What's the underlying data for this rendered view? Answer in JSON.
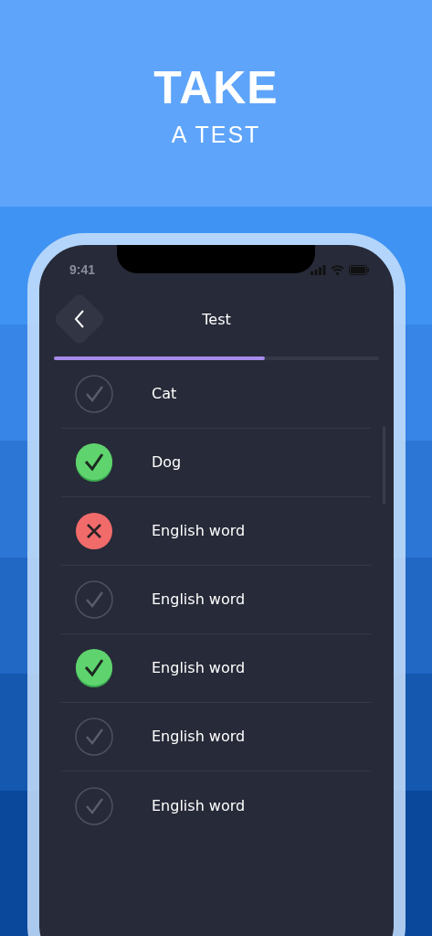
{
  "banner": {
    "title": "TAKE",
    "subtitle": "A TEST"
  },
  "status_bar": {
    "time": "9:41"
  },
  "header": {
    "title": "Test"
  },
  "progress": {
    "level": 0.65
  },
  "items": [
    {
      "label": "Cat",
      "kind": "unanswered"
    },
    {
      "label": "Dog",
      "kind": "correct"
    },
    {
      "label": "English word",
      "kind": "wrong"
    },
    {
      "label": "English word",
      "kind": "unanswered"
    },
    {
      "label": "English word",
      "kind": "correct"
    },
    {
      "label": "English word",
      "kind": "unanswered"
    },
    {
      "label": "English word",
      "kind": "unanswered"
    }
  ]
}
